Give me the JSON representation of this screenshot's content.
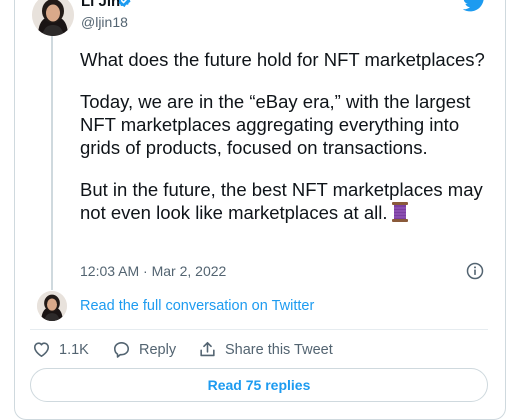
{
  "author": {
    "name": "Li Jin",
    "handle": "@ljin18",
    "verified": true
  },
  "tweet": {
    "paragraphs": [
      "What does the future hold for NFT marketplaces?",
      "Today, we are in the “eBay era,” with the largest NFT marketplaces aggregating everything into grids of products, focused on transactions.",
      "But in the future, the best NFT marketplaces may not even look like marketplaces at all."
    ],
    "trailing_emoji": "thread-spool-icon",
    "timestamp": "12:03 AM · Mar 2, 2022"
  },
  "conversation_link": "Read the full conversation on Twitter",
  "actions": {
    "likes_count": "1.1K",
    "reply_label": "Reply",
    "share_label": "Share this Tweet"
  },
  "replies_button": "Read 75 replies",
  "colors": {
    "accent": "#1d9bf0",
    "text_primary": "#0f1419",
    "text_secondary": "#536471",
    "border": "#cfd9de",
    "spool": "#7b3fa0"
  }
}
